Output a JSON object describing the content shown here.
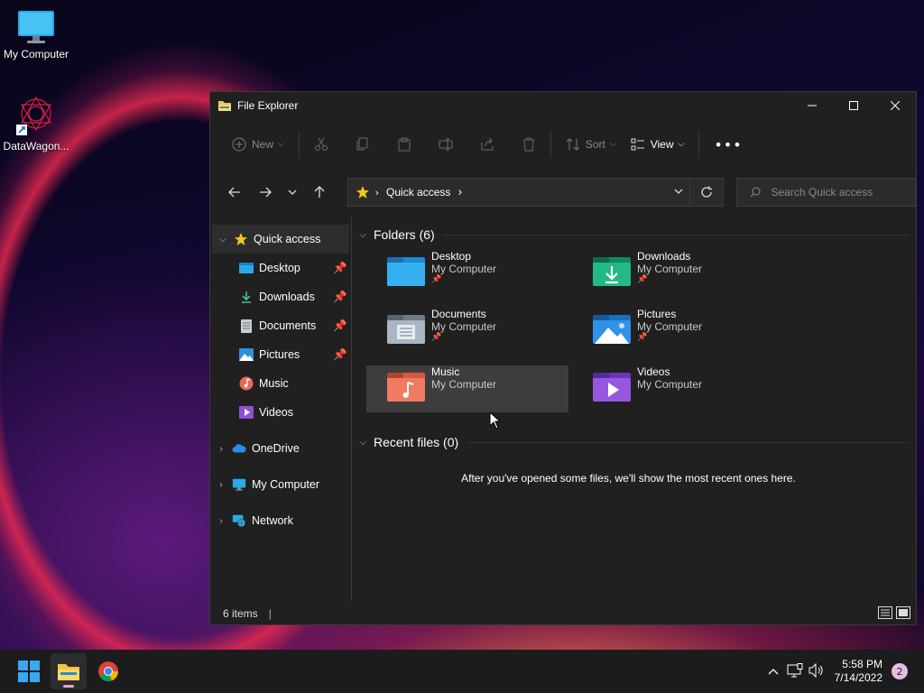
{
  "desktop": {
    "icons": [
      {
        "label": "My Computer"
      },
      {
        "label": "DataWagon..."
      }
    ]
  },
  "window": {
    "title": "File Explorer",
    "toolbar": {
      "new_label": "New",
      "sort_label": "Sort",
      "view_label": "View"
    },
    "address": {
      "crumb": "Quick access",
      "search_placeholder": "Search Quick access"
    },
    "sidebar": {
      "quick_access": "Quick access",
      "pinned": [
        {
          "label": "Desktop"
        },
        {
          "label": "Downloads"
        },
        {
          "label": "Documents"
        },
        {
          "label": "Pictures"
        },
        {
          "label": "Music"
        },
        {
          "label": "Videos"
        }
      ],
      "roots": [
        {
          "label": "OneDrive"
        },
        {
          "label": "My Computer"
        },
        {
          "label": "Network"
        }
      ]
    },
    "content": {
      "folders_header": "Folders (6)",
      "folders": [
        {
          "name": "Desktop",
          "location": "My Computer"
        },
        {
          "name": "Downloads",
          "location": "My Computer"
        },
        {
          "name": "Documents",
          "location": "My Computer"
        },
        {
          "name": "Pictures",
          "location": "My Computer"
        },
        {
          "name": "Music",
          "location": "My Computer"
        },
        {
          "name": "Videos",
          "location": "My Computer"
        }
      ],
      "recent_header": "Recent files (0)",
      "recent_empty": "After you've opened some files, we'll show the most recent ones here."
    },
    "status": {
      "items": "6 items"
    }
  },
  "taskbar": {
    "time": "5:58 PM",
    "date": "7/14/2022",
    "notification_count": "2"
  },
  "colors": {
    "window_bg": "#202020",
    "selected_bg": "#2d2d2d",
    "hover_bg": "#3d3d3d",
    "accent": "#0078d4"
  }
}
